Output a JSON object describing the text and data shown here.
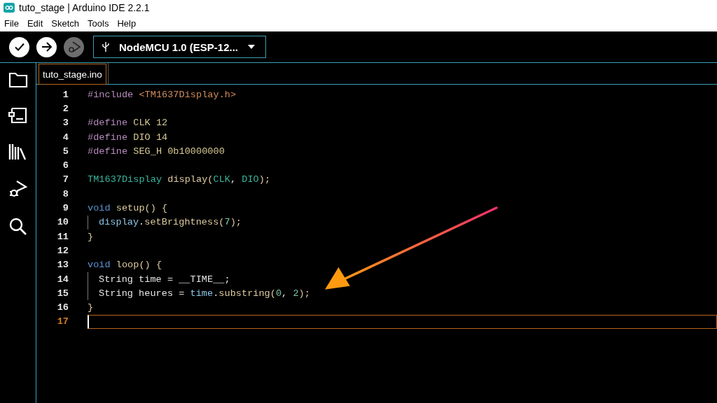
{
  "window": {
    "title": "tuto_stage | Arduino IDE 2.2.1"
  },
  "menu": [
    "File",
    "Edit",
    "Sketch",
    "Tools",
    "Help"
  ],
  "toolbar": {
    "buttons": [
      {
        "kind": "verify",
        "disabled": false
      },
      {
        "kind": "upload",
        "disabled": false
      },
      {
        "kind": "debug",
        "disabled": true
      }
    ],
    "board": "NodeMCU 1.0 (ESP-12..."
  },
  "sidebar": {
    "items": [
      {
        "kind": "folder"
      },
      {
        "kind": "board"
      },
      {
        "kind": "library"
      },
      {
        "kind": "debug"
      },
      {
        "kind": "search"
      }
    ]
  },
  "tabs": [
    {
      "label": "tuto_stage.ino",
      "selected": true
    }
  ],
  "editor": {
    "lines": [
      {
        "number": "1",
        "current": false,
        "indented": false,
        "tokens": [
          {
            "kind": "directive",
            "text": "#include"
          },
          {
            "kind": "include",
            "text": " <TM1637Display.h>"
          }
        ]
      },
      {
        "number": "2",
        "current": false,
        "indented": false
      },
      {
        "number": "3",
        "current": false,
        "indented": false,
        "tokens": [
          {
            "kind": "directive",
            "text": "#define"
          },
          {
            "kind": "macro",
            "text": " CLK 12"
          }
        ]
      },
      {
        "number": "4",
        "current": false,
        "indented": false,
        "tokens": [
          {
            "kind": "directive",
            "text": "#define"
          },
          {
            "kind": "macro",
            "text": " DIO 14"
          }
        ]
      },
      {
        "number": "5",
        "current": false,
        "indented": false,
        "tokens": [
          {
            "kind": "directive",
            "text": "#define"
          },
          {
            "kind": "macro",
            "text": " SEG_H 0b10000000"
          }
        ]
      },
      {
        "number": "6",
        "current": false,
        "indented": false
      },
      {
        "number": "7",
        "current": false,
        "indented": false,
        "tokens": [
          {
            "kind": "type",
            "text": "TM1637Display"
          },
          {
            "kind": "func",
            "text": " display("
          },
          {
            "kind": "type",
            "text": "CLK"
          },
          {
            "kind": "plain",
            "text": ", "
          },
          {
            "kind": "type",
            "text": "DIO"
          },
          {
            "kind": "func",
            "text": ");"
          }
        ]
      },
      {
        "number": "8",
        "current": false,
        "indented": false
      },
      {
        "number": "9",
        "current": false,
        "indented": false,
        "tokens": [
          {
            "kind": "keyword",
            "text": "void"
          },
          {
            "kind": "func",
            "text": " setup() {"
          }
        ]
      },
      {
        "number": "10",
        "current": false,
        "indented": true,
        "tokens": [
          {
            "kind": "var",
            "text": "display"
          },
          {
            "kind": "plain",
            "text": "."
          },
          {
            "kind": "func",
            "text": "setBrightness("
          },
          {
            "kind": "number",
            "text": "7"
          },
          {
            "kind": "func",
            "text": ");"
          }
        ]
      },
      {
        "number": "11",
        "current": false,
        "indented": false,
        "tokens": [
          {
            "kind": "func",
            "text": "}"
          }
        ]
      },
      {
        "number": "12",
        "current": false,
        "indented": false
      },
      {
        "number": "13",
        "current": false,
        "indented": false,
        "tokens": [
          {
            "kind": "keyword",
            "text": "void"
          },
          {
            "kind": "func",
            "text": " loop() {"
          }
        ]
      },
      {
        "number": "14",
        "current": false,
        "indented": true,
        "tokens": [
          {
            "kind": "plain",
            "text": "String time = __TIME__;"
          }
        ]
      },
      {
        "number": "15",
        "current": false,
        "indented": true,
        "tokens": [
          {
            "kind": "plain",
            "text": "String heures = "
          },
          {
            "kind": "var",
            "text": "time"
          },
          {
            "kind": "plain",
            "text": "."
          },
          {
            "kind": "func",
            "text": "substring("
          },
          {
            "kind": "number",
            "text": "0"
          },
          {
            "kind": "plain",
            "text": ", "
          },
          {
            "kind": "number",
            "text": "2"
          },
          {
            "kind": "func",
            "text": ");"
          }
        ]
      },
      {
        "number": "16",
        "current": false,
        "indented": false,
        "tokens": [
          {
            "kind": "func",
            "text": "}"
          }
        ]
      },
      {
        "number": "17",
        "current": true,
        "indented": false
      }
    ]
  }
}
